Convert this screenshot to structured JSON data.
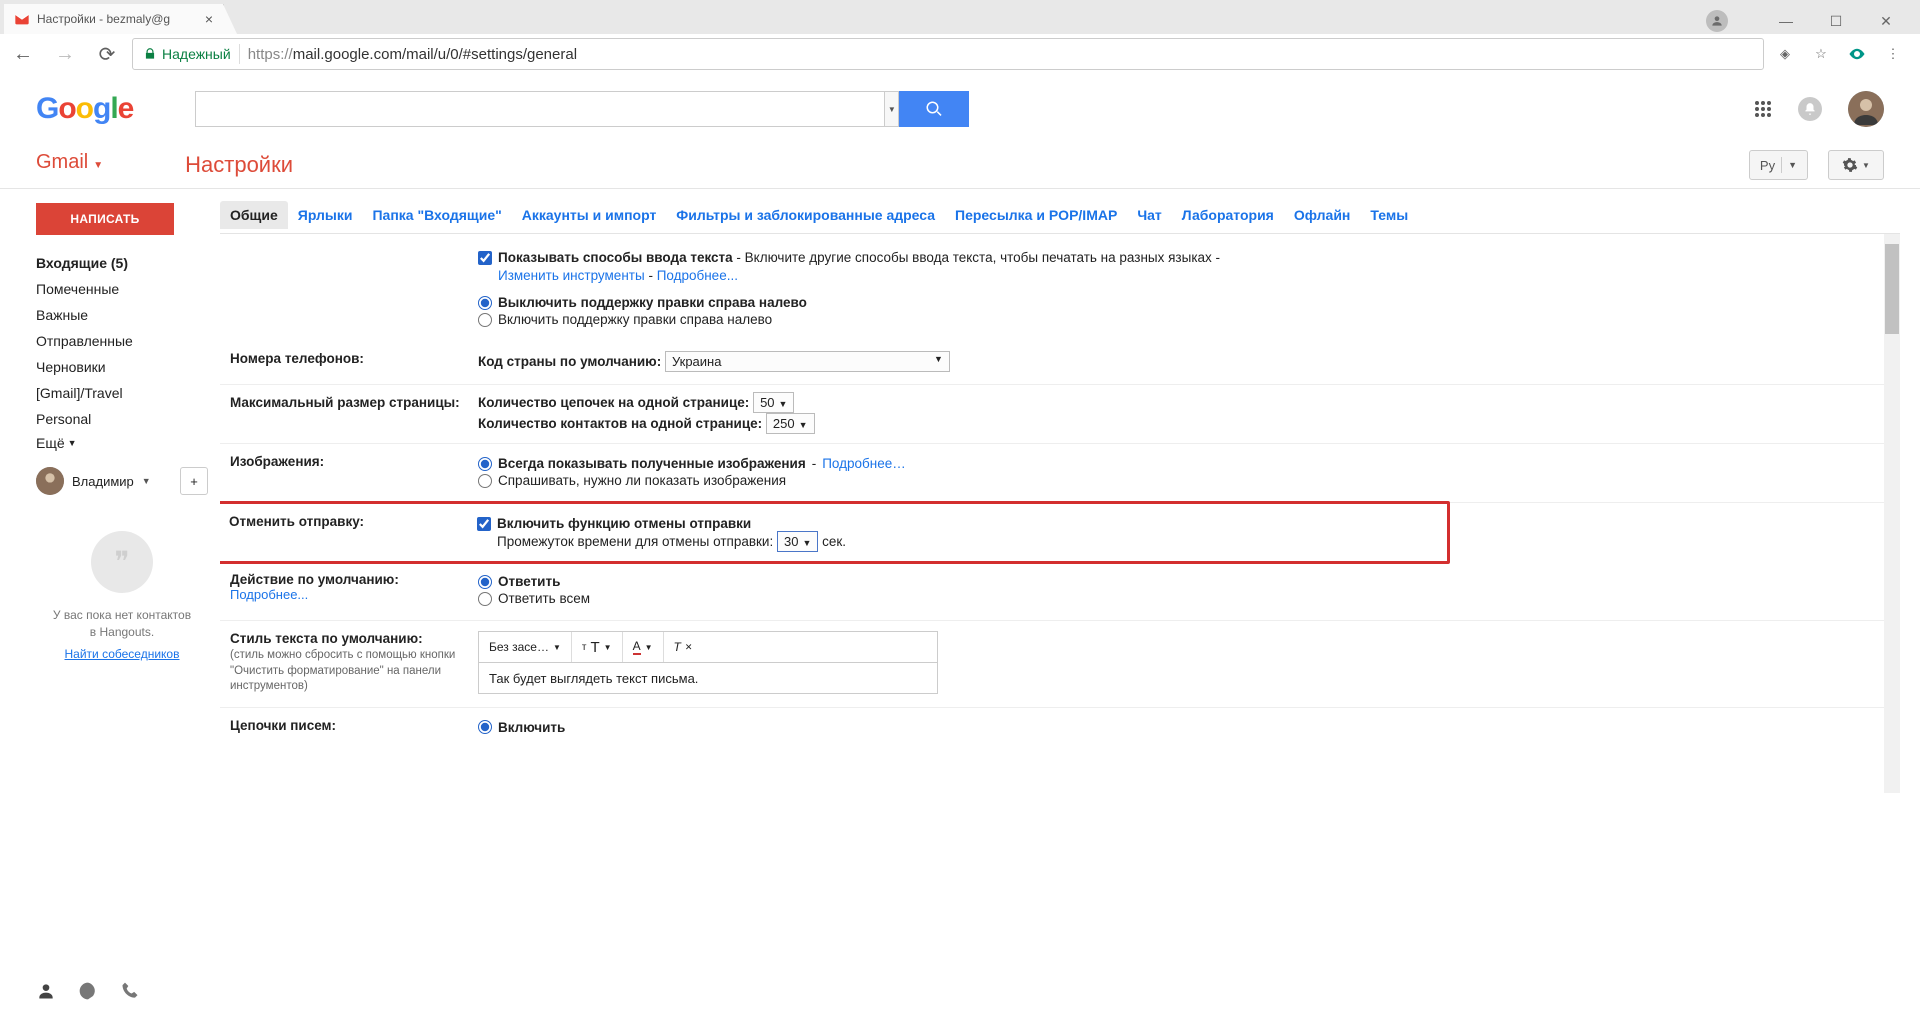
{
  "browser": {
    "tab_title": "Настройки - bezmaly@g",
    "secure_label": "Надежный",
    "url_proto": "https://",
    "url_rest": "mail.google.com/mail/u/0/#settings/general"
  },
  "google": {
    "logo_letters": [
      "G",
      "o",
      "o",
      "g",
      "l",
      "e"
    ],
    "logo_colors": [
      "#4285f4",
      "#ea4335",
      "#fbbc05",
      "#4285f4",
      "#34a853",
      "#ea4335"
    ]
  },
  "header": {
    "gmail_label": "Gmail",
    "settings_title": "Настройки",
    "lang_short": "Ру"
  },
  "sidebar": {
    "compose": "НАПИСАТЬ",
    "items": [
      {
        "label": "Входящие (5)",
        "bold": true
      },
      {
        "label": "Помеченные",
        "bold": false
      },
      {
        "label": "Важные",
        "bold": false
      },
      {
        "label": "Отправленные",
        "bold": false
      },
      {
        "label": "Черновики",
        "bold": false
      },
      {
        "label": "[Gmail]/Travel",
        "bold": false
      },
      {
        "label": "Personal",
        "bold": false
      }
    ],
    "more_label": "Ещё",
    "user_name": "Владимир",
    "hangouts": {
      "line1": "У вас пока нет контактов",
      "line2": "в Hangouts.",
      "link": "Найти собеседников"
    }
  },
  "tabs": [
    "Общие",
    "Ярлыки",
    "Папка \"Входящие\"",
    "Аккаунты и импорт",
    "Фильтры и заблокированные адреса",
    "Пересылка и POP/IMAP",
    "Чат",
    "Лаборатория",
    "Офлайн",
    "Темы"
  ],
  "settings": {
    "input_methods": {
      "label": "Показывать способы ввода текста",
      "desc": "- Включите другие способы ввода текста, чтобы печатать на разных языках -",
      "edit_link": "Изменить инструменты",
      "more_link": "Подробнее..."
    },
    "rtl": {
      "off": "Выключить поддержку правки справа налево",
      "on": "Включить поддержку правки справа налево"
    },
    "phones": {
      "label": "Номера телефонов:",
      "default_country": "Код страны по умолчанию:",
      "country_value": "Украина"
    },
    "page_size": {
      "label": "Максимальный размер страницы:",
      "threads": "Количество цепочек на одной странице:",
      "threads_val": "50",
      "contacts": "Количество контактов на одной странице:",
      "contacts_val": "250"
    },
    "images": {
      "label": "Изображения:",
      "always": "Всегда показывать полученные изображения",
      "more": "Подробнее…",
      "ask": "Спрашивать, нужно ли показать изображения"
    },
    "undo": {
      "label": "Отменить отправку:",
      "enable": "Включить функцию отмены отправки",
      "delay_label": "Промежуток времени для отмены отправки:",
      "delay_val": "30",
      "delay_unit": "сек."
    },
    "default_reply": {
      "label": "Действие по умолчанию:",
      "more": "Подробнее...",
      "reply": "Ответить",
      "reply_all": "Ответить всем"
    },
    "default_text_style": {
      "label": "Стиль текста по умолчанию:",
      "sub": "(стиль можно сбросить с помощью кнопки \"Очистить форматирование\" на панели инструментов)",
      "font_pick": "Без засе…",
      "sample": "Так будет выглядеть текст письма."
    },
    "threads": {
      "label": "Цепочки писем:",
      "on": "Включить"
    }
  }
}
